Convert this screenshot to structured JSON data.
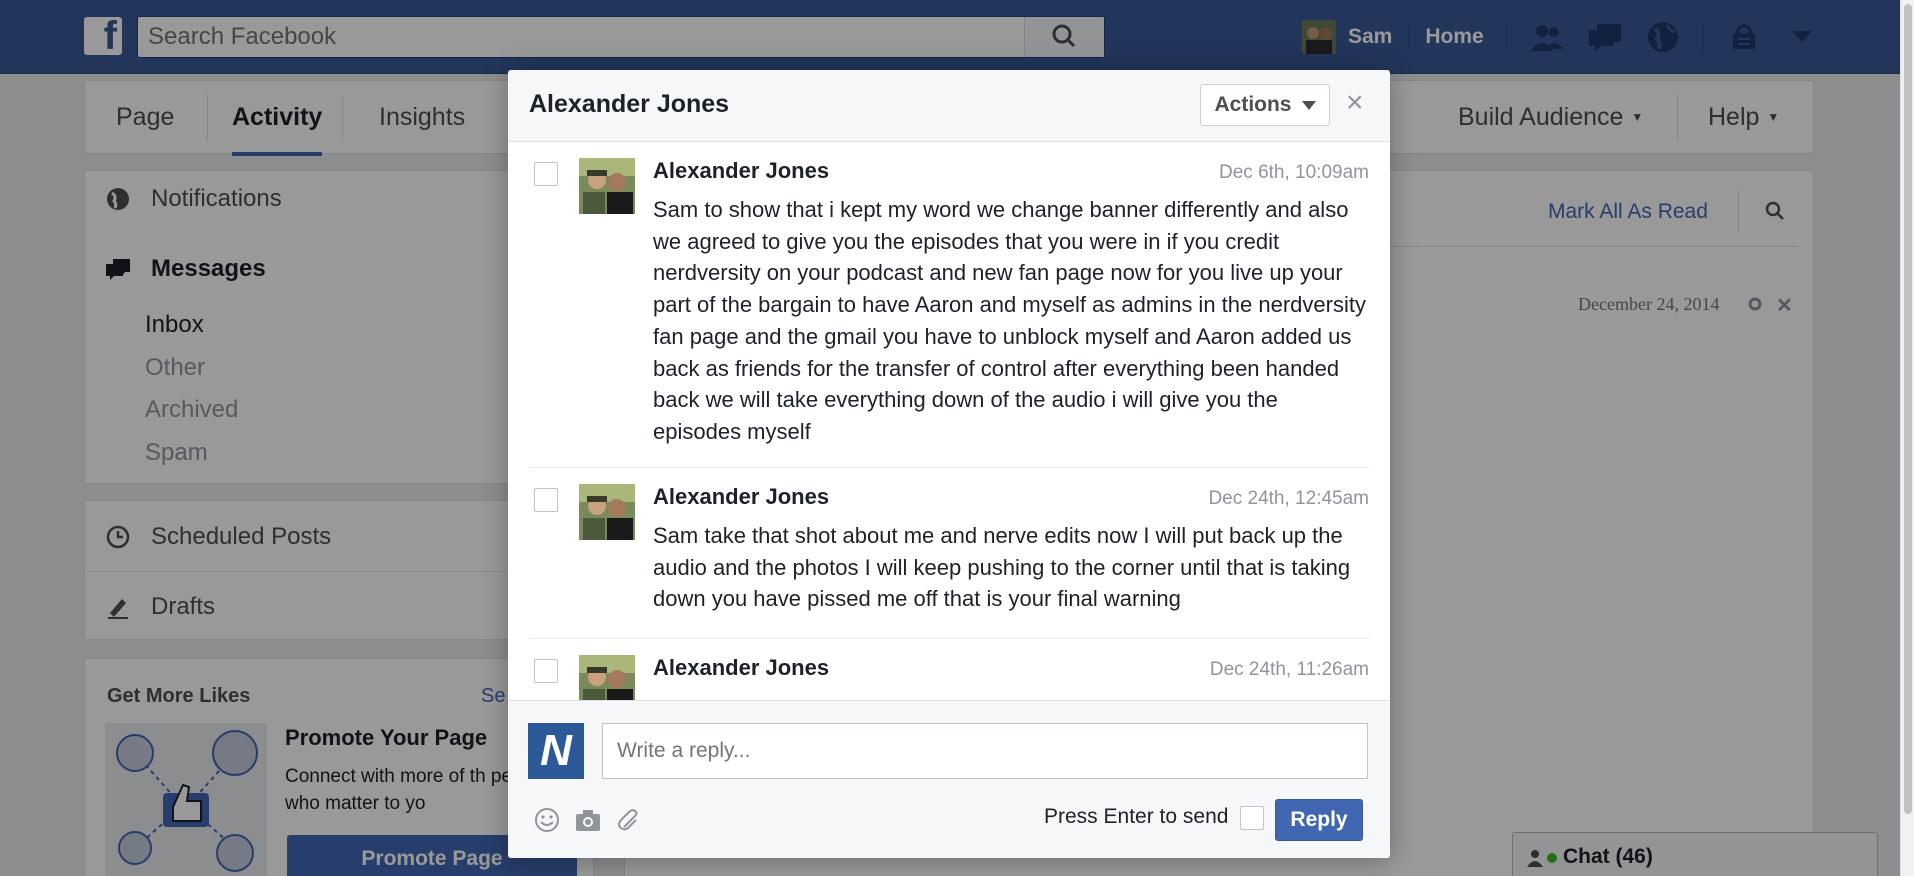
{
  "topbar": {
    "logo": "f",
    "search_placeholder": "Search Facebook",
    "user_name": "Sam",
    "home_label": "Home"
  },
  "page_nav": {
    "tabs": [
      {
        "label": "Page"
      },
      {
        "label": "Activity"
      },
      {
        "label": "Insights"
      }
    ],
    "build_audience": "Build Audience",
    "help": "Help",
    "caret": "▼"
  },
  "left": {
    "notifications": "Notifications",
    "messages": "Messages",
    "inbox": "Inbox",
    "other": "Other",
    "archived": "Archived",
    "spam": "Spam",
    "scheduled": "Scheduled Posts",
    "drafts": "Drafts"
  },
  "likes": {
    "title": "Get More Likes",
    "see": "Se",
    "promo_title": "Promote Your Page",
    "promo_text": "Connect with more of th people who matter to yo",
    "promo_button": "Promote Page"
  },
  "right": {
    "mark_all_read": "Mark All As Read",
    "date": "December 24, 2014",
    "chat_label": "Chat (46)"
  },
  "dialog": {
    "title": "Alexander Jones",
    "actions_label": "Actions",
    "close": "×",
    "messages": [
      {
        "name": "Alexander Jones",
        "date": "Dec 6th, 10:09am",
        "text": "Sam to show that i kept my word we change banner differently and also we agreed to give you the episodes that you were in if you credit nerdversity on your podcast and new fan page now for you live up your part of the bargain to have Aaron and myself as admins in the nerdversity fan page and the gmail you have to unblock myself and Aaron added us back as friends for the transfer of control after everything been handed back we will take everything down of the audio i will give you the episodes myself"
      },
      {
        "name": "Alexander Jones",
        "date": "Dec 24th, 12:45am",
        "text": "Sam take that shot about me and nerve edits now I will put back up the audio and the photos I will keep pushing to the corner until that is taking down you have pissed me off that is your final warning"
      },
      {
        "name": "Alexander Jones",
        "date": "Dec 24th, 11:26am",
        "text": ""
      }
    ],
    "composer": {
      "logo": "N",
      "placeholder": "Write a reply...",
      "press_enter": "Press Enter to send",
      "reply_label": "Reply"
    }
  },
  "colors": {
    "brand": "#3b5998",
    "button": "#4267b2"
  }
}
